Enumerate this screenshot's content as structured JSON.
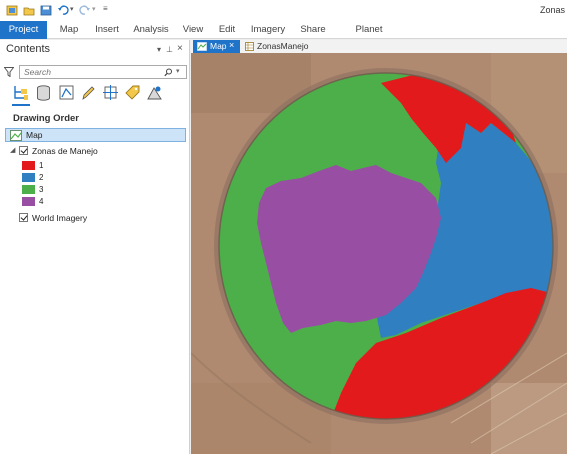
{
  "app": {
    "window_title": "Zonas",
    "qat_icons": [
      "new-project-icon",
      "open-project-icon",
      "save-icon",
      "print-icon",
      "undo-icon",
      "redo-icon",
      "customize-qat-icon"
    ]
  },
  "ribbon": {
    "tabs": [
      {
        "label": "Project",
        "active": true
      },
      {
        "label": "Map"
      },
      {
        "label": "Insert"
      },
      {
        "label": "Analysis"
      },
      {
        "label": "View"
      },
      {
        "label": "Edit"
      },
      {
        "label": "Imagery"
      },
      {
        "label": "Share"
      },
      {
        "label": "Planet Imagery"
      }
    ]
  },
  "contents": {
    "title": "Contents",
    "pin_symbol": "▾ ⊥ ×",
    "search_placeholder": "Search",
    "toolbar_icons": [
      "list-by-drawing-order-icon",
      "list-by-source-icon",
      "list-by-selection-icon",
      "list-by-editing-icon",
      "list-by-snapping-icon",
      "list-by-labeling-icon",
      "list-by-perspective-imagery-icon"
    ],
    "section_heading": "Drawing Order",
    "map_label": "Map",
    "layer": {
      "name": "Zonas de Manejo",
      "checked": true,
      "legend": [
        {
          "label": "1",
          "color": "#e31a1c"
        },
        {
          "label": "2",
          "color": "#2f7fc1"
        },
        {
          "label": "3",
          "color": "#4daf4a"
        },
        {
          "label": "4",
          "color": "#984ea3"
        }
      ]
    },
    "basemap": {
      "name": "World Imagery",
      "checked": true
    }
  },
  "map_view": {
    "tabs": [
      {
        "label": "Map",
        "active": true
      },
      {
        "label": "ZonasManejo"
      }
    ],
    "colors": {
      "soil": "#a9836a",
      "zone1": "#e31a1c",
      "zone2": "#2f7fc1",
      "zone3": "#4daf4a",
      "zone4": "#984ea3"
    }
  }
}
